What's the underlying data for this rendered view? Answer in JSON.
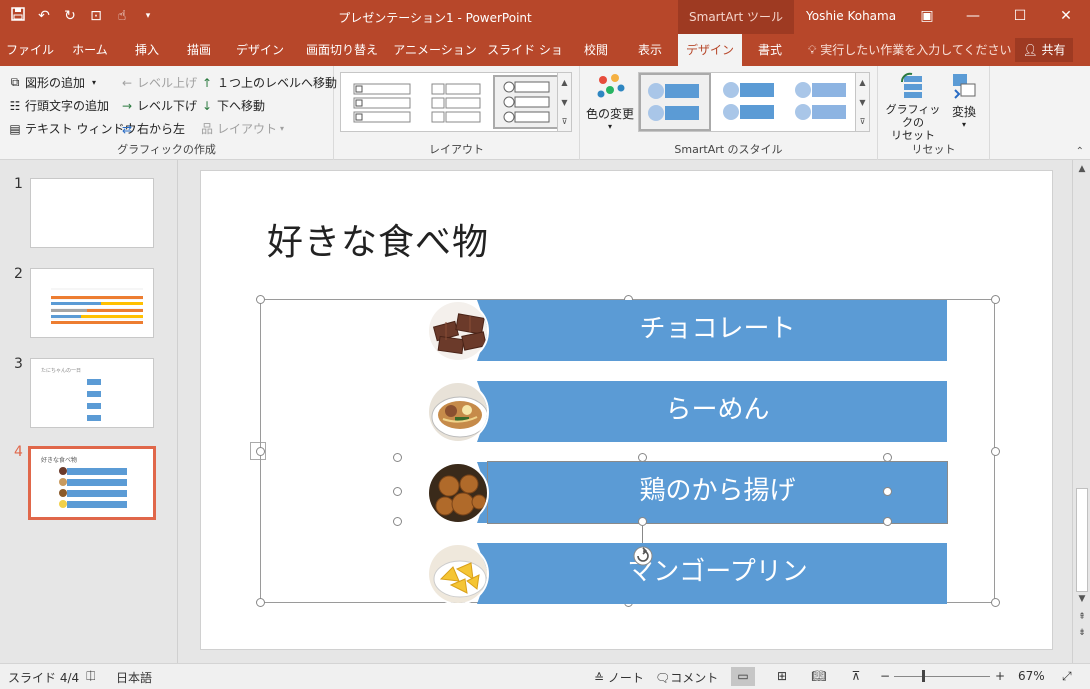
{
  "app": {
    "doc_title": "プレゼンテーション1 - PowerPoint",
    "context_header": "SmartArt ツール",
    "user": "Yoshie Kohama"
  },
  "tabs": [
    "ファイル",
    "ホーム",
    "挿入",
    "描画",
    "デザイン",
    "画面切り替え",
    "アニメーション",
    "スライド ショー",
    "校閲",
    "表示",
    "デザイン",
    "書式"
  ],
  "tell_me": "実行したい作業を入力してください",
  "share": "共有",
  "ribbon": {
    "create": {
      "add_shape": "図形の追加",
      "add_bullet": "行頭文字の追加",
      "text_pane": "テキスト ウィンドウ",
      "promote": "レベル上げ",
      "demote": "レベル下げ",
      "rtl": "右から左",
      "move_up": "１つ上のレベルへ移動",
      "move_down": "下へ移動",
      "layout": "レイアウト",
      "label": "グラフィックの作成"
    },
    "layouts_label": "レイアウト",
    "change_colors": "色の変更",
    "styles_label": "SmartArt のスタイル",
    "reset_graphic": "グラフィックの\nリセット",
    "convert": "変換",
    "reset_label": "リセット"
  },
  "thumbnails": {
    "numbers": [
      "1",
      "2",
      "3",
      "4"
    ],
    "slide3_title": "たにちゃんの一日",
    "slide4_title": "好きな食べ物"
  },
  "slide": {
    "title": "好きな食べ物",
    "items": [
      "チョコレート",
      "らーめん",
      "鶏のから揚げ",
      "マンゴープリン"
    ]
  },
  "status": {
    "slide_pos": "スライド 4/4",
    "language": "日本語",
    "notes": "ノート",
    "comments": "コメント",
    "zoom": "67%"
  },
  "colors": {
    "accent": "#b7472a",
    "smartart_fill": "#5b9bd5"
  }
}
